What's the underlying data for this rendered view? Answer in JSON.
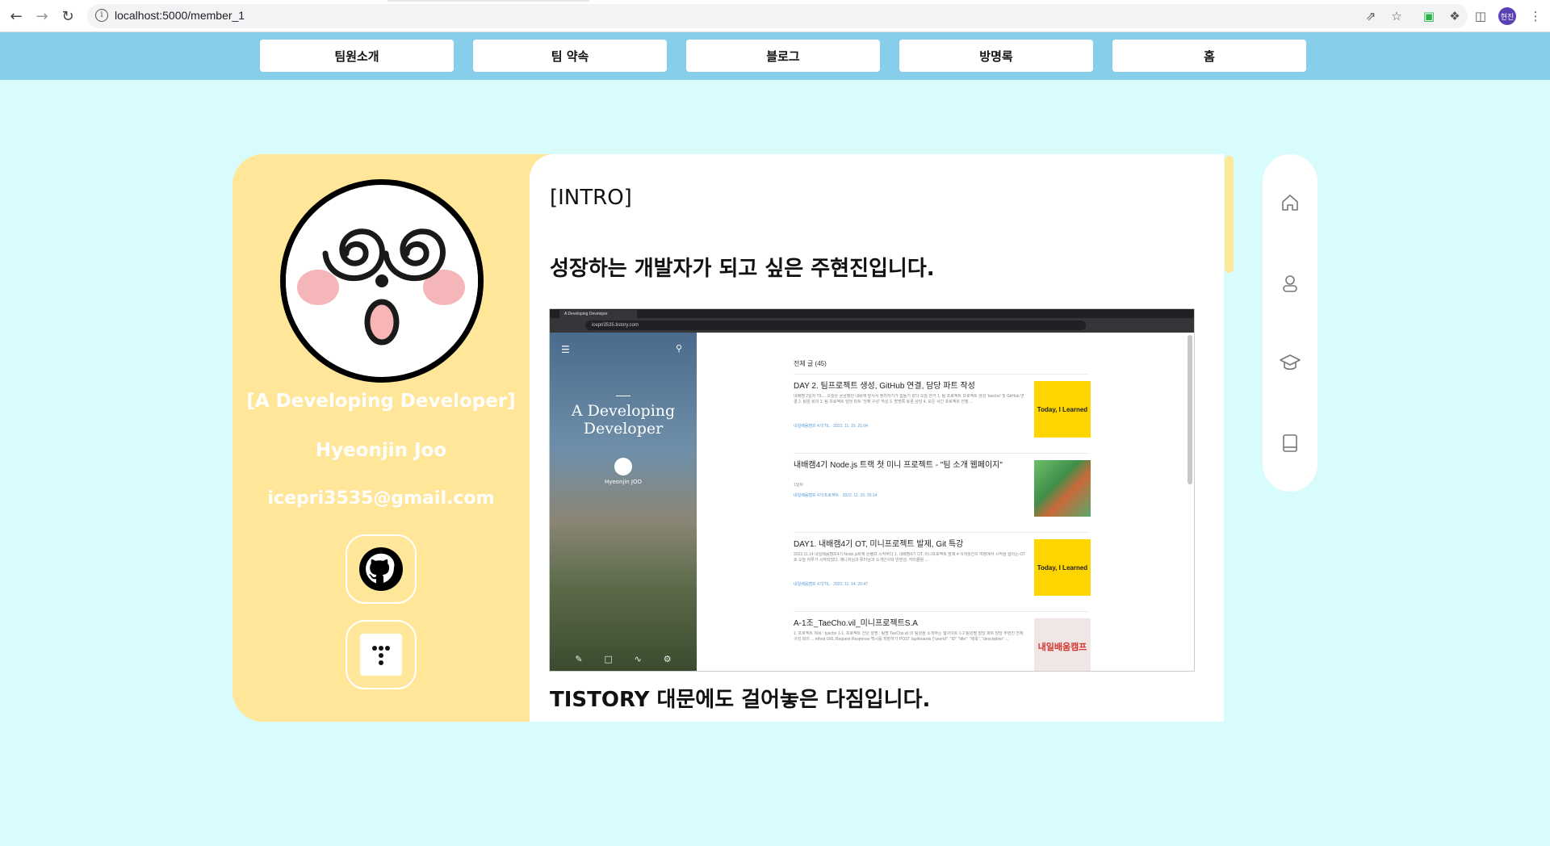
{
  "browser": {
    "url": "localhost:5000/member_1",
    "profile_initials": "현진"
  },
  "nav": {
    "items": [
      {
        "label": "팀원소개"
      },
      {
        "label": "팀 약속"
      },
      {
        "label": "블로그"
      },
      {
        "label": "방명록"
      },
      {
        "label": "홈"
      }
    ]
  },
  "profile": {
    "tagline": "[A Developing Developer]",
    "name": "Hyeonjin Joo",
    "email": "icepri3535@gmail.com",
    "links": [
      {
        "icon": "github-icon"
      },
      {
        "icon": "tistory-icon"
      }
    ]
  },
  "intro": {
    "title": "[INTRO]",
    "line1": "성장하는 개발자가 되고 싶은 주현진입니다.",
    "line2": "TISTORY 대문에도 걸어놓은 다짐입니다."
  },
  "embedded_screenshot": {
    "tab_title": "A Developing Developer",
    "url": "icepri3535.tistory.com",
    "blog_title": "A Developing Developer",
    "blog_user": "Hyeonjin JOO",
    "post_count_label": "전체 글 (45)",
    "posts": [
      {
        "title": "DAY 2. 팀프로젝트 생성, GitHub 연결, 담당 파트 작성",
        "summary": "내배캠 2일차 TIL... 오늘은 곰곰했던 내용에 앞서서 정리하기가 힘들기 같다 오늘 한거 1. 팀 프로젝트 프로젝트 생성 'taecho' 및 GitHub 연결 2. 팀원 회의 3. 팀 프로젝트 담당 파트 '전체 구성' 작성 3. 방명록 토론 상당 4. 모든 서간 프로젝트 진행 ...",
        "meta": "내일배움캠프 4기/TIL  ·  2022. 11. 15. 21:04",
        "thumb": "Today, I Learned"
      },
      {
        "title": "내배캠4기 Node.js 트랙 첫 미니 프로젝트 - \"팀 소개 웹페이지\"",
        "summary": "1일차",
        "meta": "내일배움캠프 4기/프로젝트  ·  2022. 11. 15. 20:14",
        "thumb": ""
      },
      {
        "title": "DAY1. 내배캠4기 OT, 미니프로젝트 발제, Git 특강",
        "summary": "2022.11.14 내일배움캠프4기 Node.js트랙 온램프 시작하다 1. 내배캠4기 OT, 미니프로젝트 발제 4~5개월간의 여정에서 시작을 알리는 OT로 오늘 하루가 시작되었다. 매니저님과 튜터님과 소개인사와 반편성, 커리큘럼 ...",
        "meta": "내일배움캠프 4기/TIL  ·  2022. 11. 14. 20:47",
        "thumb": "Today, I Learned"
      },
      {
        "title": "A-1조_TaeCho.vil_미니프로젝트S.A",
        "summary": "1. 프로젝트 제목 : tyacho 1-1. 프로젝트 간단 설명 : 팀명 TaeCho.vil 의 팀원을 소개하는 웹사이트 1-2 팀원별 담당 파트 담당 주현진 전체 구성 회의 ... ethod URL Request Response 백시를 저장하기 POST /api/boards {\"userId\": \"ID\" \"title\": \"제목\", \"description\" ...",
        "meta": "",
        "thumb": "내일배움캠프"
      }
    ]
  },
  "side_nav": {
    "icons": [
      "home-icon",
      "person-icon",
      "graduation-cap-icon",
      "book-icon"
    ]
  },
  "colors": {
    "page_bg": "#d8fbfb",
    "navbar": "#87ceeb",
    "card_left": "#ffe699",
    "card_right": "#ffffff"
  }
}
